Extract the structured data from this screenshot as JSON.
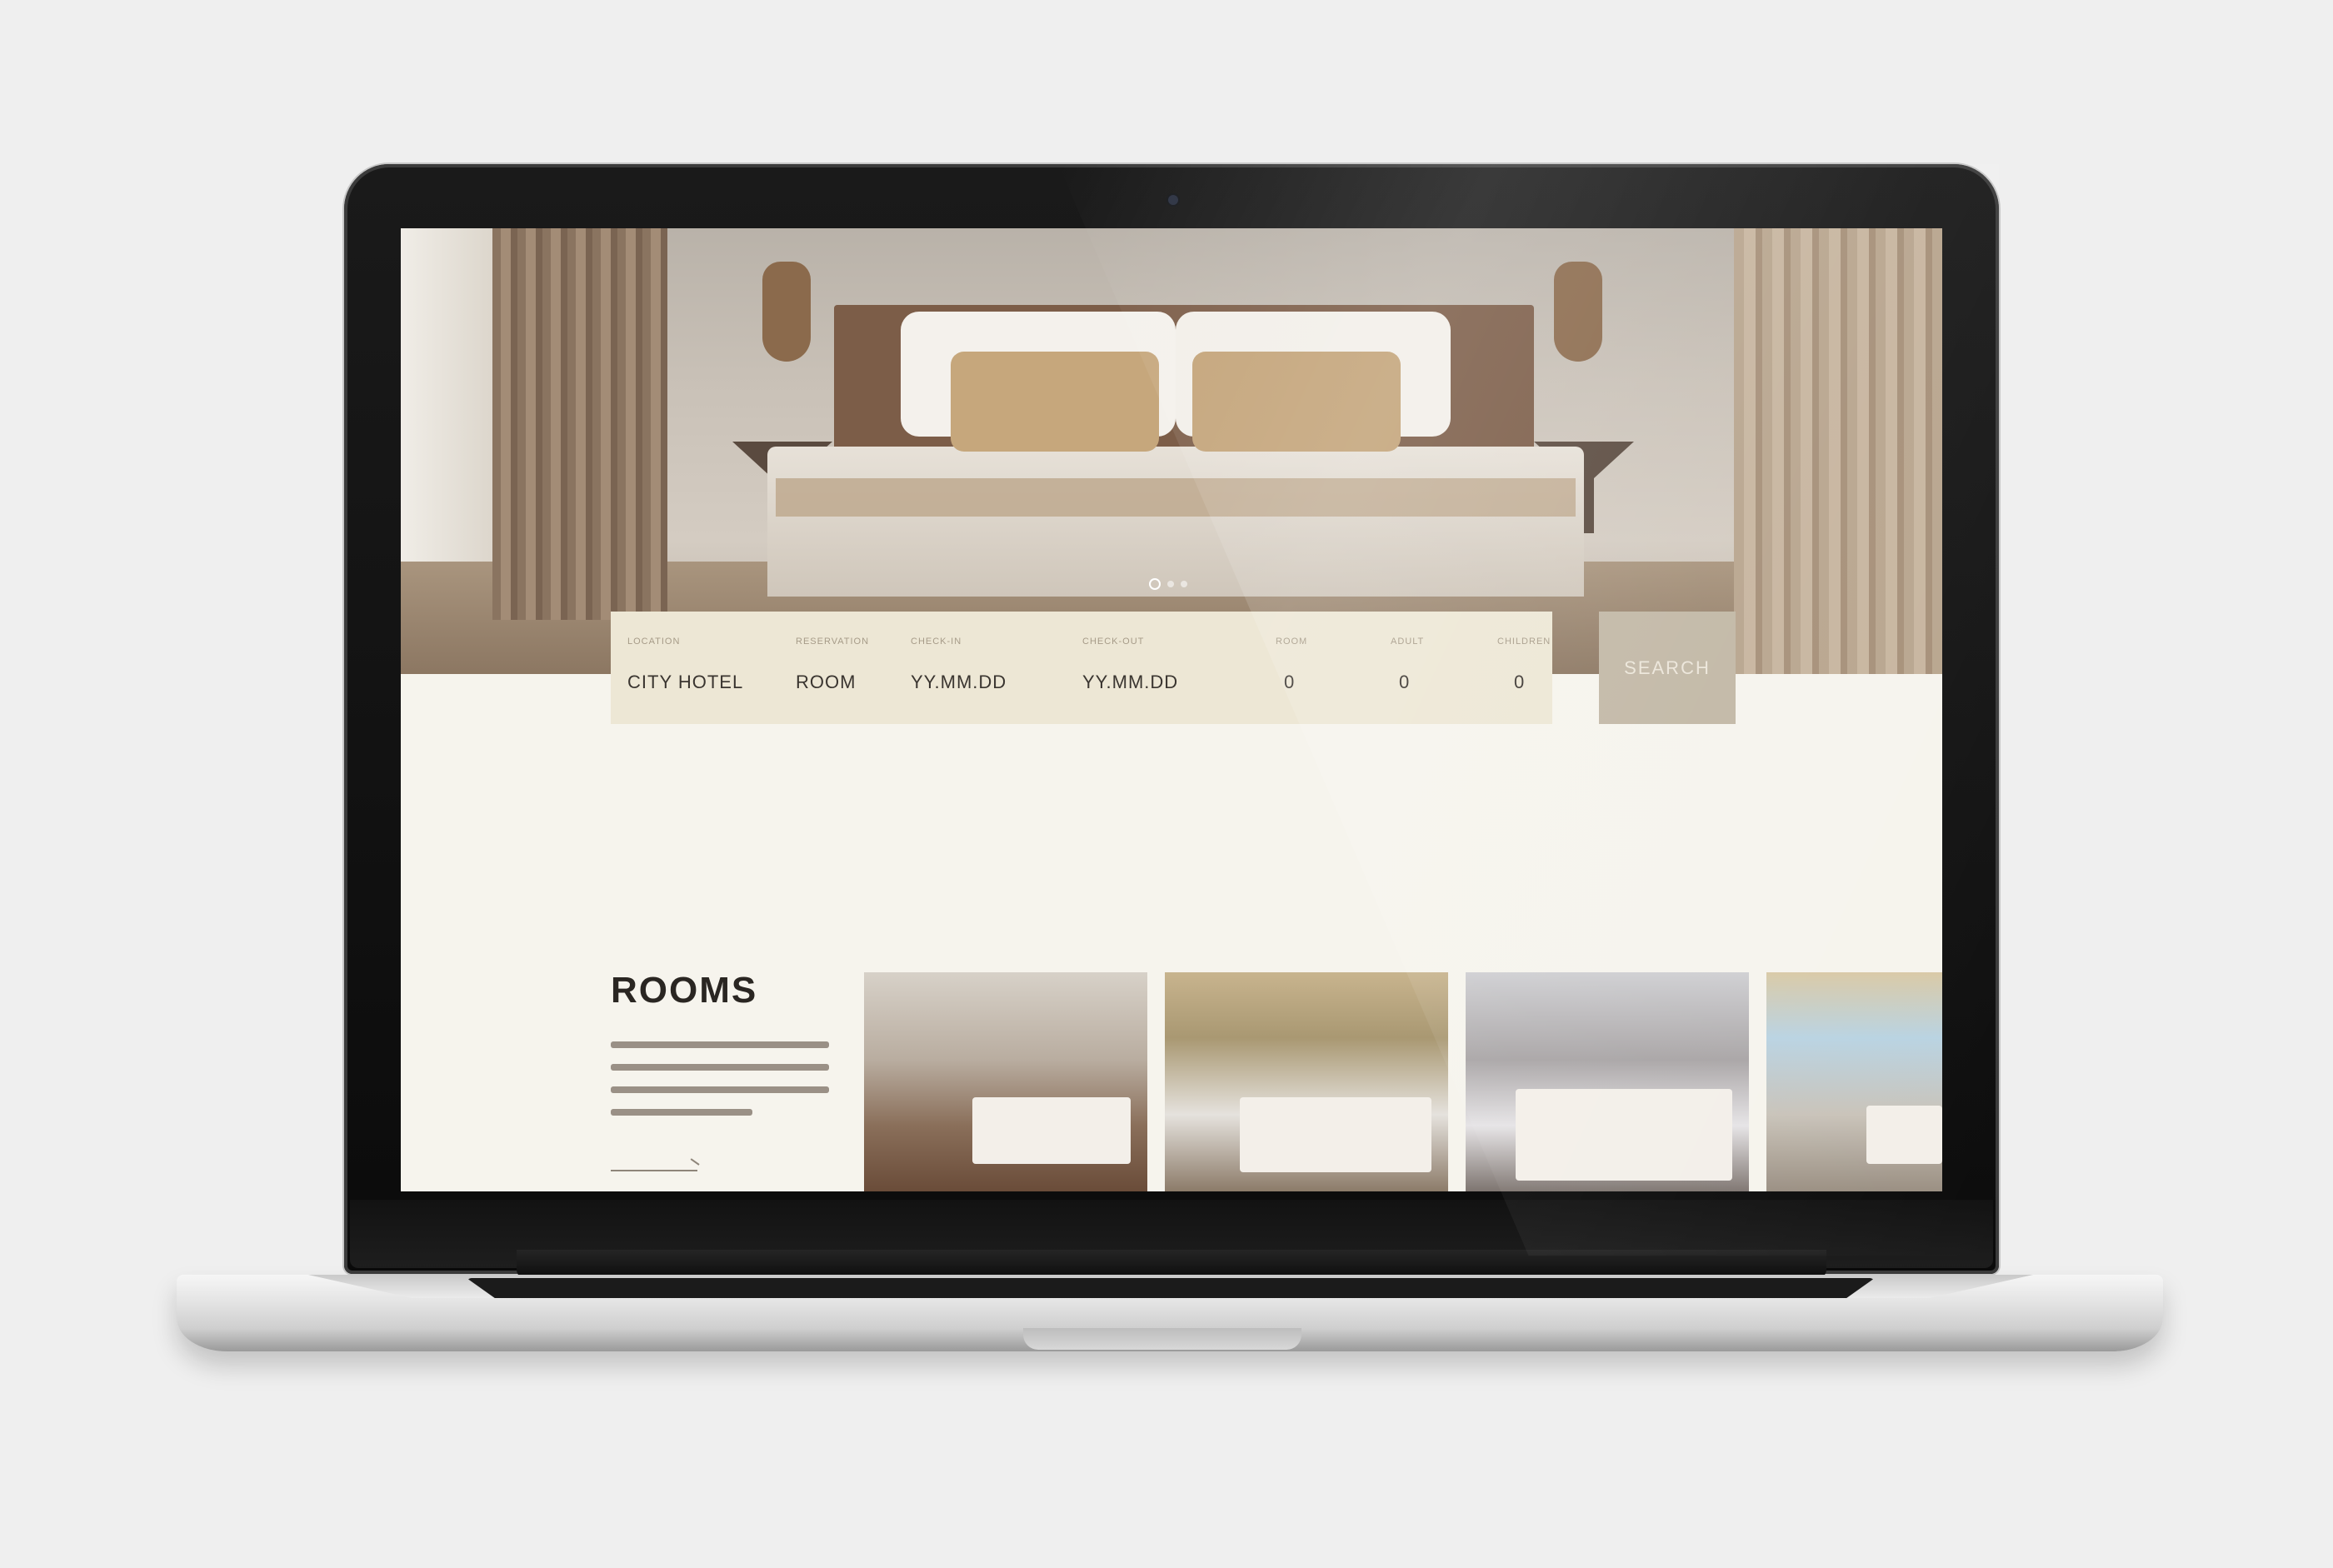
{
  "booking": {
    "fields": [
      {
        "label": "LOCATION",
        "value": "CITY HOTEL"
      },
      {
        "label": "RESERVATION",
        "value": "ROOM"
      },
      {
        "label": "CHECK-IN",
        "value": "YY.MM.DD"
      },
      {
        "label": "CHECK-OUT",
        "value": "YY.MM.DD"
      },
      {
        "label": "ROOM",
        "value": "0"
      },
      {
        "label": "ADULT",
        "value": "0"
      },
      {
        "label": "CHILDREN",
        "value": "0"
      }
    ],
    "search_label": "SEARCH"
  },
  "rooms": {
    "title": "ROOMS"
  },
  "colors": {
    "background": "#f6f4ed",
    "booking_bar": "#ede7d5",
    "search_button": "#c2b8a6"
  }
}
